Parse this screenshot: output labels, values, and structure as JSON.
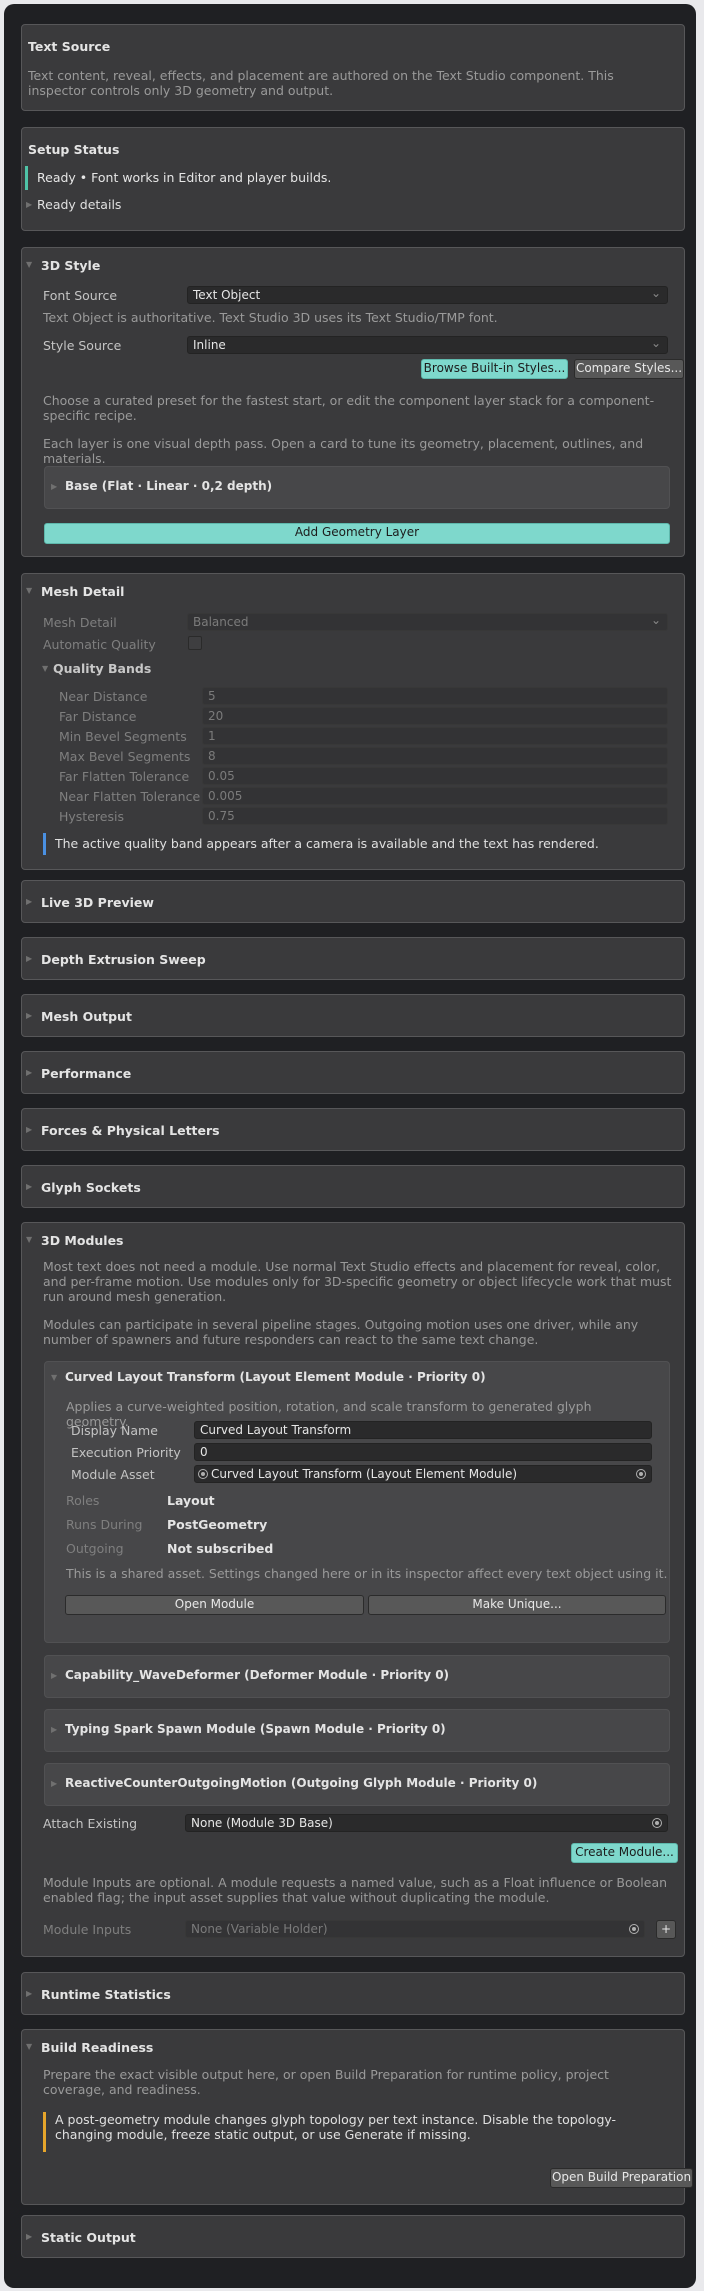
{
  "text_source": {
    "title": "Text Source",
    "body": "Text content, reveal, effects, and placement are authored on the Text Studio component. This inspector controls only 3D geometry and output."
  },
  "setup_status": {
    "title": "Setup Status",
    "ready": "Ready • Font works in Editor and player builds.",
    "details": "Ready details"
  },
  "style": {
    "title": "3D Style",
    "font_source_label": "Font Source",
    "font_source_value": "Text Object",
    "font_note": "Text Object is authoritative. Text Studio 3D uses its Text Studio/TMP font.",
    "style_source_label": "Style Source",
    "style_source_value": "Inline",
    "browse_button": "Browse Built-in Styles...",
    "compare_button": "Compare Styles...",
    "intro1": "Choose a curated preset for the fastest start, or edit the component layer stack for a component-specific recipe.",
    "intro2": "Each layer is one visual depth pass. Open a card to tune its geometry, placement, outlines, and materials.",
    "base_layer": "Base (Flat · Linear · 0,2 depth)",
    "add_layer_button": "Add Geometry Layer"
  },
  "mesh_detail": {
    "title": "Mesh Detail",
    "mesh_detail_label": "Mesh Detail",
    "mesh_detail_value": "Balanced",
    "auto_quality_label": "Automatic Quality",
    "quality_bands_label": "Quality Bands",
    "bands": [
      {
        "label": "Near Distance",
        "value": "5"
      },
      {
        "label": "Far Distance",
        "value": "20"
      },
      {
        "label": "Min Bevel Segments",
        "value": "1"
      },
      {
        "label": "Max Bevel Segments",
        "value": "8"
      },
      {
        "label": "Far Flatten Tolerance",
        "value": "0.05"
      },
      {
        "label": "Near Flatten Tolerance",
        "value": "0.005"
      },
      {
        "label": "Hysteresis",
        "value": "0.75"
      }
    ],
    "note": "The active quality band appears after a camera is available and the text has rendered."
  },
  "collapsed": {
    "live_preview": "Live 3D Preview",
    "depth_sweep": "Depth Extrusion Sweep",
    "mesh_output": "Mesh Output",
    "performance": "Performance",
    "forces": "Forces & Physical Letters",
    "glyph_sockets": "Glyph Sockets",
    "runtime_stats": "Runtime Statistics",
    "static_output": "Static Output"
  },
  "modules": {
    "title": "3D Modules",
    "intro1": "Most text does not need a module. Use normal Text Studio effects and placement for reveal, color, and per-frame motion. Use modules only for 3D-specific geometry or object lifecycle work that must run around mesh generation.",
    "intro2": "Modules can participate in several pipeline stages. Outgoing motion uses one driver, while any number of spawners and future responders can react to the same text change.",
    "curved": {
      "title": "Curved Layout Transform (Layout Element Module · Priority 0)",
      "desc": "Applies a curve-weighted position, rotation, and scale transform to generated glyph geometry.",
      "display_name_label": "Display Name",
      "display_name_value": "Curved Layout Transform",
      "exec_priority_label": "Execution Priority",
      "exec_priority_value": "0",
      "module_asset_label": "Module Asset",
      "module_asset_value": "Curved Layout Transform (Layout Element Module)",
      "roles_label": "Roles",
      "roles_value": "Layout",
      "runs_during_label": "Runs During",
      "runs_during_value": "PostGeometry",
      "outgoing_label": "Outgoing",
      "outgoing_value": "Not subscribed",
      "shared_note": "This is a shared asset. Settings changed here or in its inspector affect every text object using it.",
      "open_button": "Open Module",
      "unique_button": "Make Unique..."
    },
    "wave": "Capability_WaveDeformer (Deformer Module · Priority 0)",
    "spark": "Typing Spark Spawn Module (Spawn Module · Priority 0)",
    "reactive": "ReactiveCounterOutgoingMotion (Outgoing Glyph Module · Priority 0)",
    "attach_label": "Attach Existing",
    "attach_value": "None (Module 3D Base)",
    "create_button": "Create Module...",
    "inputs_note": "Module Inputs are optional. A module requests a named value, such as a Float influence or Boolean enabled flag; the input asset supplies that value without duplicating the module.",
    "inputs_label": "Module Inputs",
    "inputs_value": "None (Variable Holder)",
    "add_button": "+"
  },
  "build": {
    "title": "Build Readiness",
    "intro": "Prepare the exact visible output here, or open Build Preparation for runtime policy, project coverage, and readiness.",
    "warning": "A post-geometry module changes glyph topology per text instance. Disable the topology-changing module, freeze static output, or use Generate if missing.",
    "open_button": "Open Build Preparation"
  }
}
